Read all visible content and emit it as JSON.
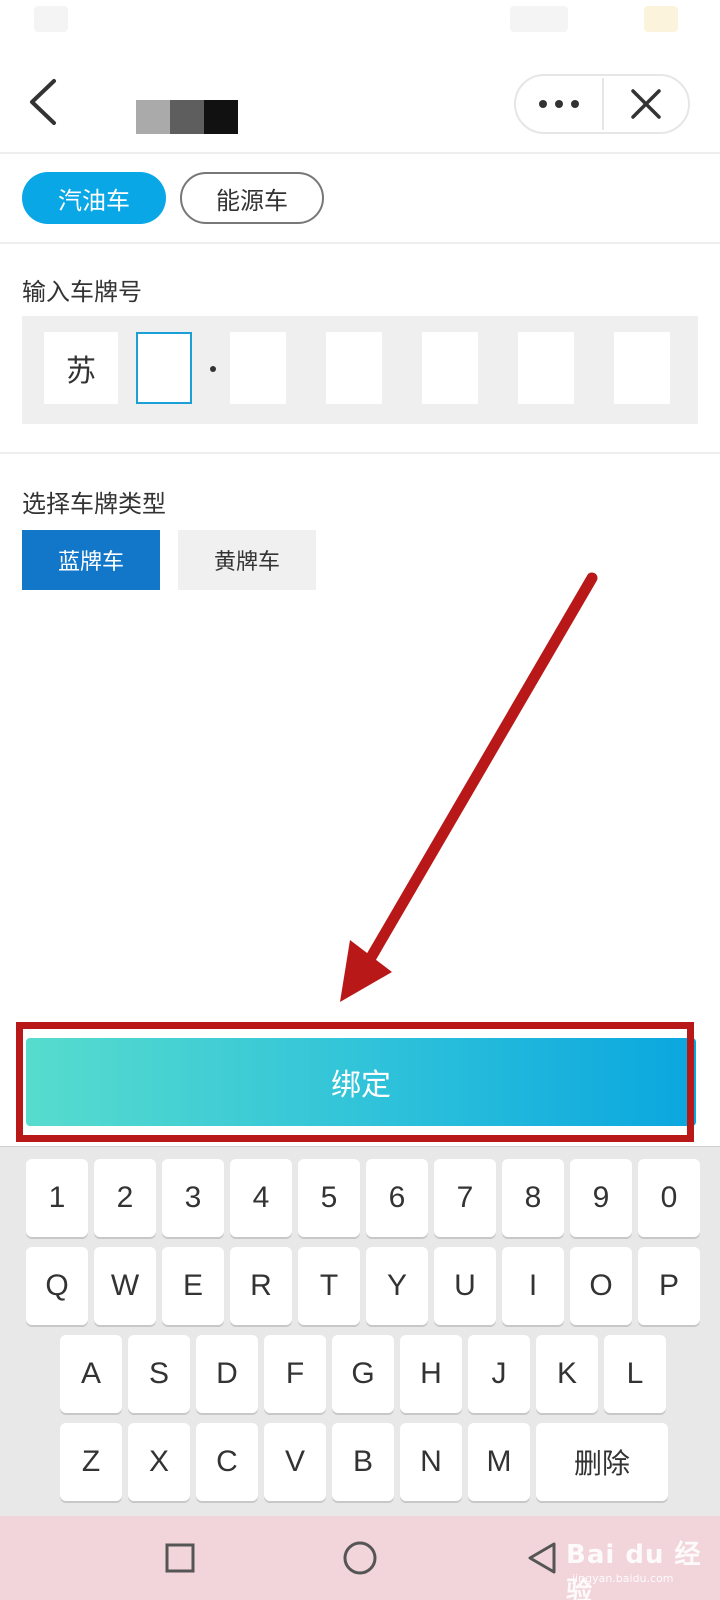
{
  "nav": {
    "title_mosaic_colors": [
      "#aaaaaa",
      "#5e5e5e",
      "#111111"
    ],
    "more_icon": "more-horizontal-icon",
    "close_icon": "close-icon",
    "back_icon": "chevron-left-icon"
  },
  "vehicle_types": {
    "selected": "汽油车",
    "options": [
      "汽油车",
      "能源车"
    ]
  },
  "plate_input": {
    "label": "输入车牌号",
    "cells": [
      "苏",
      "",
      "",
      "",
      "",
      "",
      ""
    ]
  },
  "plate_type": {
    "label": "选择车牌类型",
    "selected": "蓝牌车",
    "options": [
      "蓝牌车",
      "黄牌车"
    ]
  },
  "bind_button": {
    "label": "绑定"
  },
  "keyboard": {
    "row1": [
      "1",
      "2",
      "3",
      "4",
      "5",
      "6",
      "7",
      "8",
      "9",
      "0"
    ],
    "row2": [
      "Q",
      "W",
      "E",
      "R",
      "T",
      "Y",
      "U",
      "I",
      "O",
      "P"
    ],
    "row3": [
      "A",
      "S",
      "D",
      "F",
      "G",
      "H",
      "J",
      "K",
      "L"
    ],
    "row4": [
      "Z",
      "X",
      "C",
      "V",
      "B",
      "N",
      "M"
    ],
    "delete_label": "删除"
  },
  "system_nav": {
    "watermark": "Bai du 经验",
    "watermark_sub": "jingyan.baidu.com"
  },
  "colors": {
    "accent": "#0aa7e6",
    "plate_blue": "#1277c9",
    "annotation_red": "#b81818"
  }
}
